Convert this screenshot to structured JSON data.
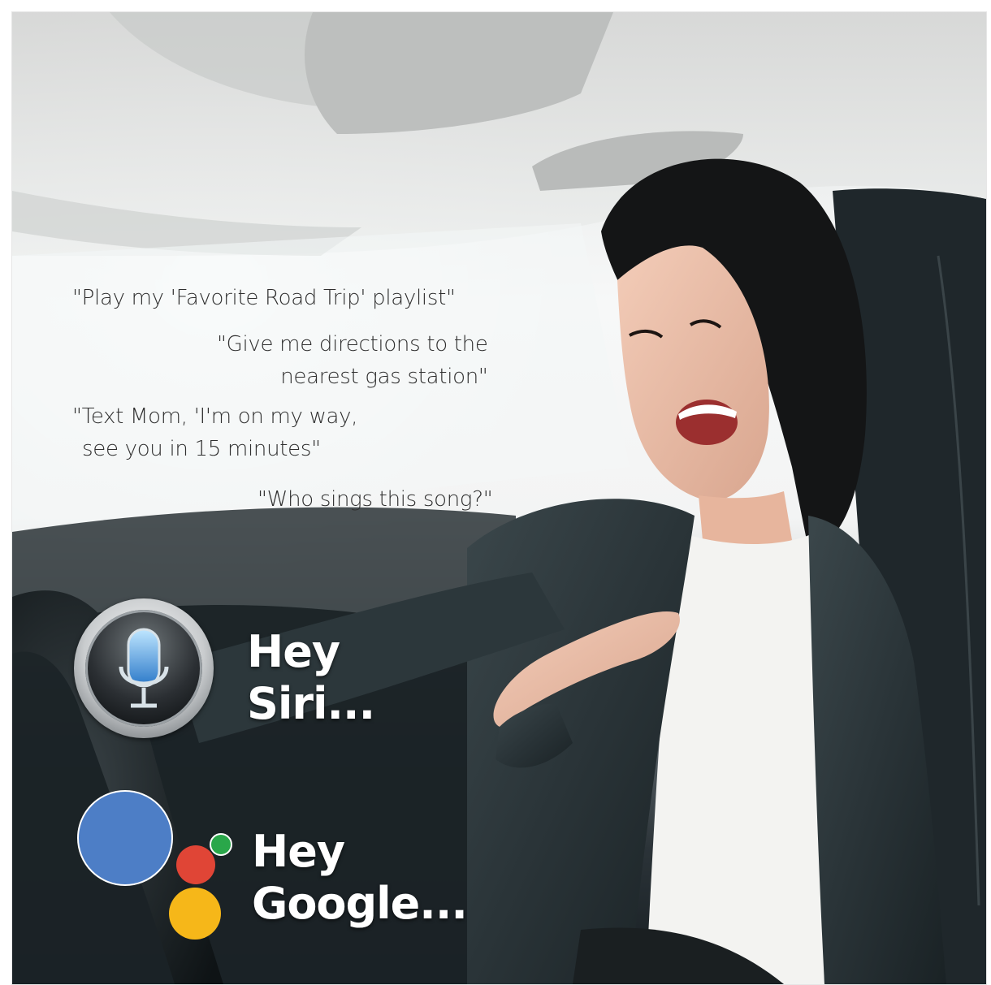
{
  "quotes": {
    "q1": "\"Play my 'Favorite Road Trip' playlist\"",
    "q2_line1": "\"Give me directions to the",
    "q2_line2": "nearest gas station\"",
    "q3_line1": "\"Text Mom, 'I'm on my way,",
    "q3_line2": "see you in 15 minutes\"",
    "q4": "\"Who sings this song?\""
  },
  "siri": {
    "icon": "microphone-icon",
    "line1": "Hey",
    "line2": "Siri..."
  },
  "google": {
    "icon": "google-assistant-dots-icon",
    "line1": "Hey",
    "line2": "Google...",
    "colors": {
      "blue": "#4d7ec6",
      "red": "#e04536",
      "green": "#2aa74a",
      "yellow": "#f6b719"
    }
  }
}
